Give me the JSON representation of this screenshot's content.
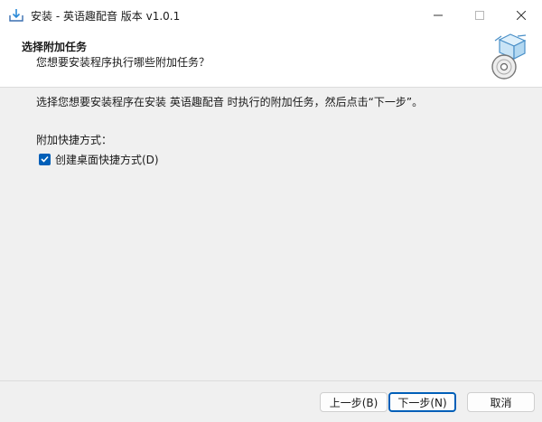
{
  "window": {
    "title": "安装 - 英语趣配音 版本 v1.0.1",
    "icon": "installer-icon",
    "controls": [
      "minimize-icon",
      "maximize-icon",
      "close-icon"
    ]
  },
  "header": {
    "title": "选择附加任务",
    "subtitle": "您想要安装程序执行哪些附加任务？",
    "image": "setup-box-disc-icon"
  },
  "body": {
    "instruction": "选择您想要安装程序在安装 英语趣配音 时执行的附加任务，然后点击“下一步”。",
    "group_label": "附加快捷方式：",
    "tasks": [
      {
        "label": "创建桌面快捷方式(D)",
        "checked": true
      }
    ]
  },
  "footer": {
    "back_label": "上一步(B)",
    "next_label": "下一步(N)",
    "cancel_label": "取消"
  },
  "colors": {
    "accent": "#005fb8",
    "header_bg": "#ffffff",
    "body_bg": "#f0f0f0"
  }
}
